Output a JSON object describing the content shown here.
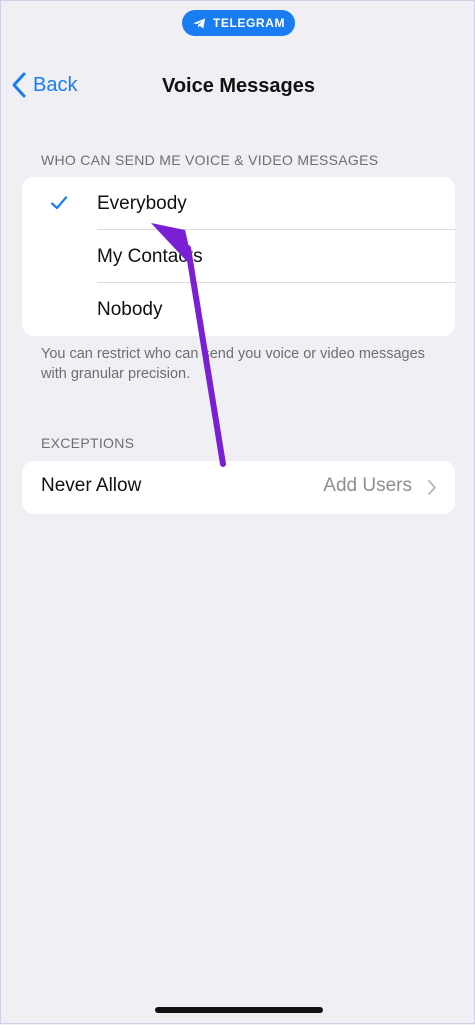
{
  "status_bar": {
    "app_label": "TELEGRAM",
    "accent_color": "#1a7cf2"
  },
  "nav": {
    "back_label": "Back",
    "title": "Voice Messages"
  },
  "privacy": {
    "header": "WHO CAN SEND ME VOICE & VIDEO MESSAGES",
    "options": [
      {
        "label": "Everybody",
        "selected": true
      },
      {
        "label": "My Contacts",
        "selected": false
      },
      {
        "label": "Nobody",
        "selected": false
      }
    ],
    "footer": "You can restrict who can send you voice or video messages with granular precision."
  },
  "exceptions": {
    "header": "EXCEPTIONS",
    "rows": [
      {
        "label": "Never Allow",
        "value": "Add Users"
      }
    ]
  },
  "annotation": {
    "arrow_color": "#7b1fd4"
  }
}
